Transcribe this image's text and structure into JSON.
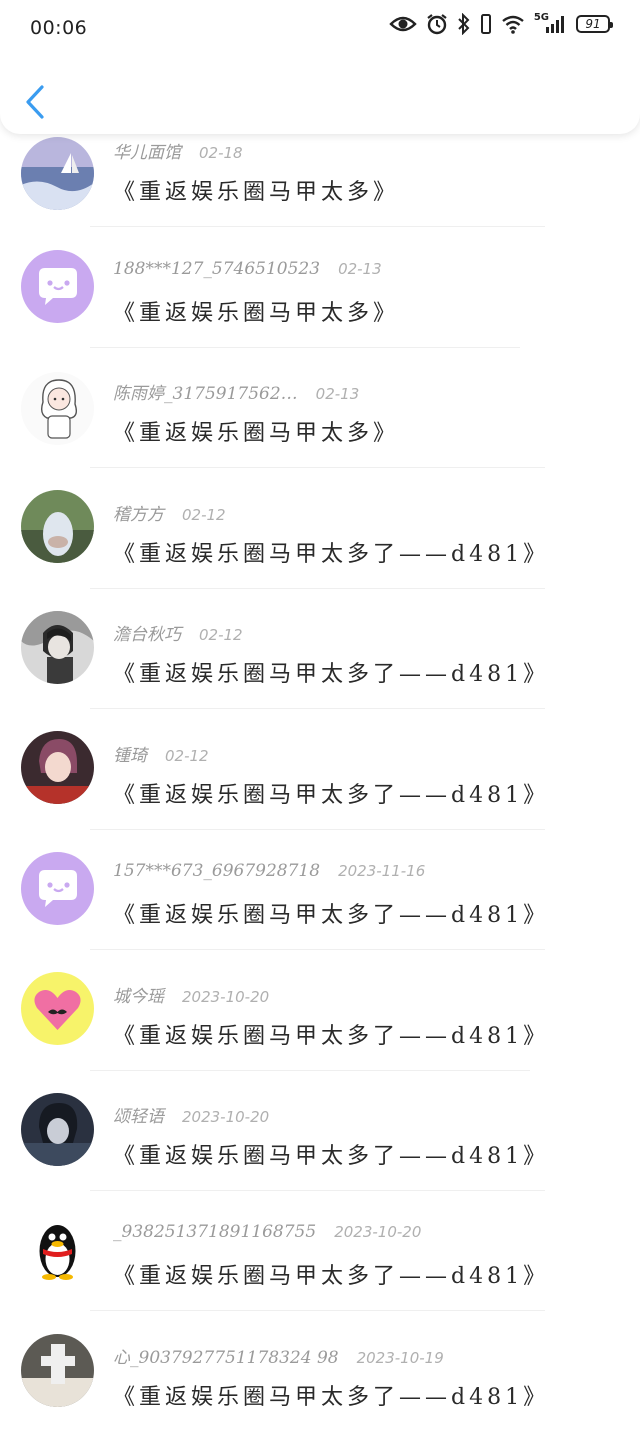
{
  "status_bar": {
    "time": "00:06",
    "network": "5G",
    "battery": "91",
    "icons": [
      "eye-icon",
      "alarm-icon",
      "bluetooth-icon",
      "vibrate-icon",
      "wifi-icon",
      "signal-icon",
      "battery-icon"
    ]
  },
  "header": {
    "back_icon": "chevron-left-icon",
    "accent_color": "#3a9cf0"
  },
  "comments": [
    {
      "user": "华儿面馆",
      "date": "02-18",
      "message": "《重返娱乐圈马甲太多》",
      "avatar": "sea-avatar"
    },
    {
      "user": "188***127_5746510523",
      "date": "02-13",
      "message": "《重返娱乐圈马甲太多》",
      "avatar": "default-purple-avatar"
    },
    {
      "user": "陈雨婷_3175917562…",
      "date": "02-13",
      "message": "《重返娱乐圈马甲太多》",
      "avatar": "cartoon-girl-avatar"
    },
    {
      "user": "稽方方",
      "date": "02-12",
      "message": "《重返娱乐圈马甲太多了——d481》",
      "avatar": "photo-avatar"
    },
    {
      "user": "澹台秋巧",
      "date": "02-12",
      "message": "《重返娱乐圈马甲太多了——d481》",
      "avatar": "anime-boy-avatar"
    },
    {
      "user": "锺琦",
      "date": "02-12",
      "message": "《重返娱乐圈马甲太多了——d481》",
      "avatar": "portrait-avatar"
    },
    {
      "user": "157***673_6967928718",
      "date": "2023-11-16",
      "message": "《重返娱乐圈马甲太多了——d481》",
      "avatar": "default-purple-avatar"
    },
    {
      "user": "城今瑶",
      "date": "2023-10-20",
      "message": "《重返娱乐圈马甲太多了——d481》",
      "avatar": "heart-mustache-avatar"
    },
    {
      "user": "颂轻语",
      "date": "2023-10-20",
      "message": "《重返娱乐圈马甲太多了——d481》",
      "avatar": "dark-anime-avatar"
    },
    {
      "user": "_938251371891168755",
      "date": "2023-10-20",
      "message": "《重返娱乐圈马甲太多了——d481》",
      "avatar": "penguin-avatar"
    },
    {
      "user": "心_9037927751178324 98",
      "date": "2023-10-19",
      "message": "《重返娱乐圈马甲太多了——d481》",
      "avatar": "photo-avatar"
    }
  ]
}
